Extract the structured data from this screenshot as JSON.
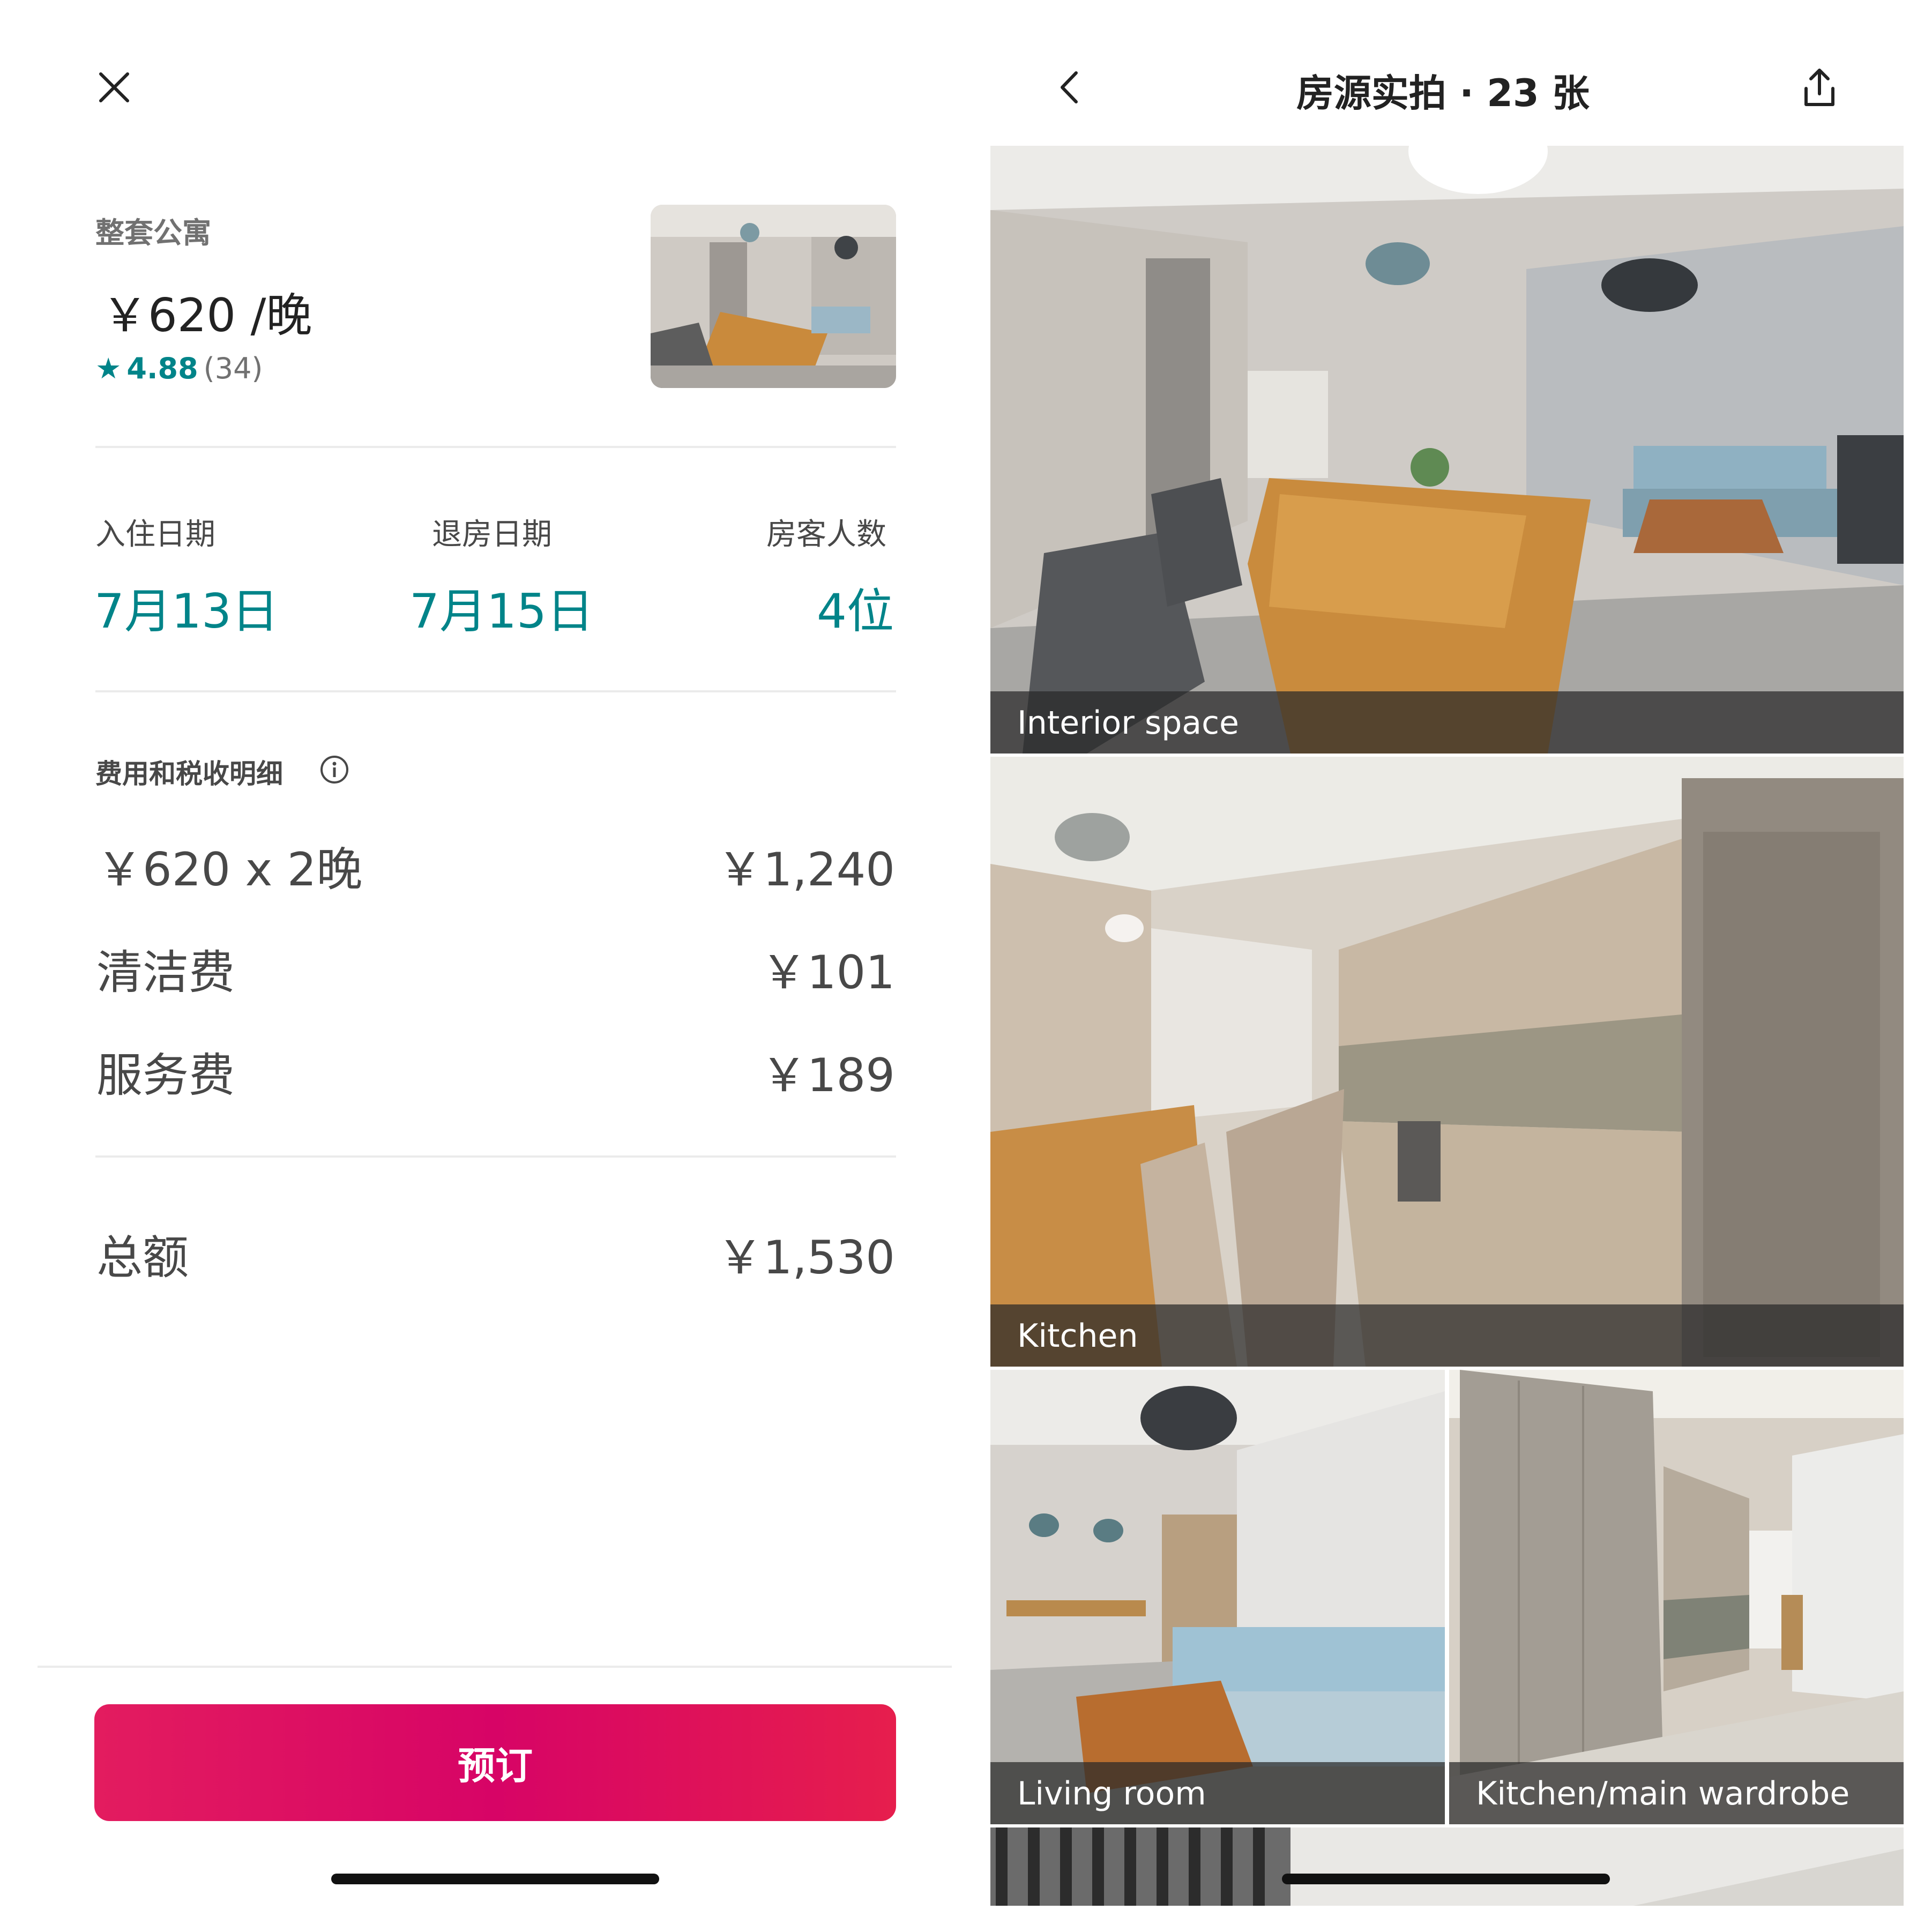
{
  "booking": {
    "listing_type": "整套公寓",
    "nightly_price": "￥620 /晚",
    "rating_score": "4.88",
    "rating_count": "(34)",
    "checkin_label": "入住日期",
    "checkin_value": "7月13日",
    "checkout_label": "退房日期",
    "checkout_value": "7月15日",
    "guests_label": "房客人数",
    "guests_value": "4位",
    "fees_title": "费用和税收明细",
    "fees": [
      {
        "label": "￥620 x 2晚",
        "value": "￥1,240"
      },
      {
        "label": "清洁费",
        "value": "￥101"
      },
      {
        "label": "服务费",
        "value": "￥189"
      }
    ],
    "total_label": "总额",
    "total_value": "￥1,530",
    "book_button": "预订"
  },
  "gallery": {
    "title": "房源实拍 · 23 张",
    "photos": [
      {
        "caption": "Interior space"
      },
      {
        "caption": "Kitchen"
      },
      {
        "caption": "Living room"
      },
      {
        "caption": "Kitchen/main wardrobe"
      }
    ]
  },
  "colors": {
    "accent_teal": "#008489",
    "book_button": "#e31c5f",
    "text_primary": "#222222",
    "text_secondary": "#717171"
  },
  "icons": [
    "close-icon",
    "star-icon",
    "info-icon",
    "back-chevron-icon",
    "share-icon"
  ]
}
